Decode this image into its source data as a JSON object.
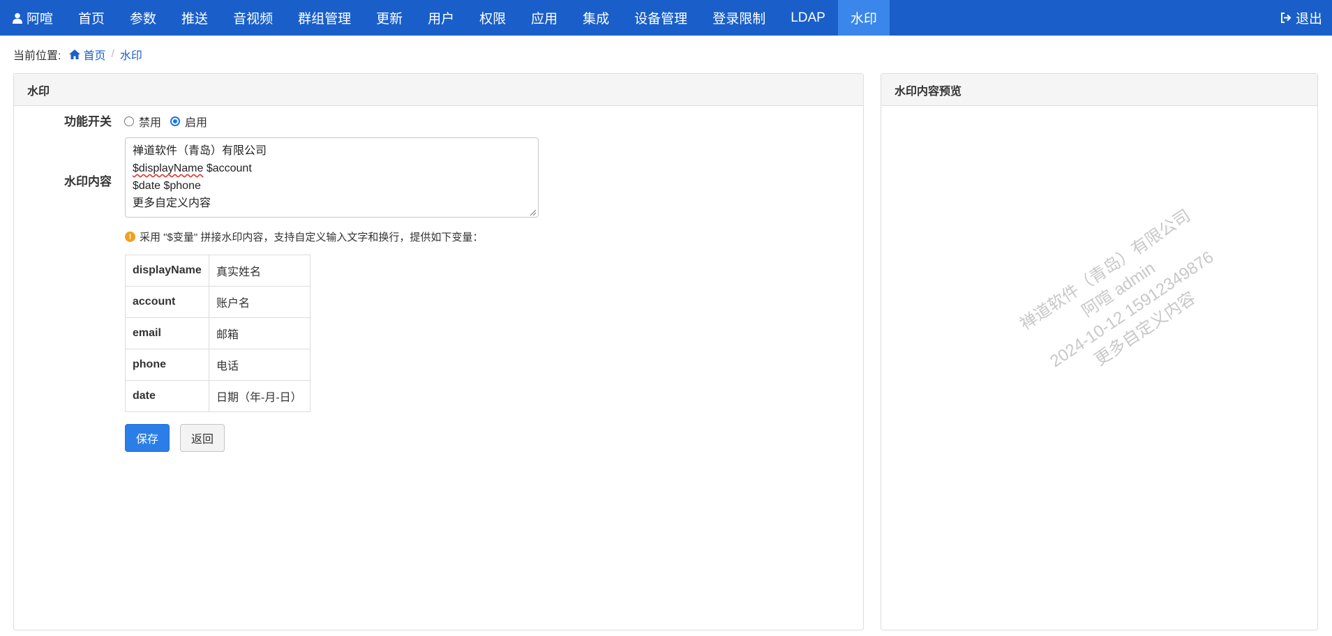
{
  "header": {
    "user": "阿喧",
    "nav": [
      "首页",
      "参数",
      "推送",
      "音视频",
      "群组管理",
      "更新",
      "用户",
      "权限",
      "应用",
      "集成",
      "设备管理",
      "登录限制",
      "LDAP",
      "水印"
    ],
    "active": "水印",
    "logout": "退出"
  },
  "breadcrumb": {
    "label": "当前位置:",
    "home": "首页",
    "current": "水印"
  },
  "form": {
    "panel_title": "水印",
    "switch_label": "功能开关",
    "disable_label": "禁用",
    "enable_label": "启用",
    "enabled": true,
    "content_label": "水印内容",
    "content_lines": [
      "禅道软件（青岛）有限公司",
      "$displayName $account",
      "$date $phone",
      "更多自定义内容"
    ],
    "tip": "采用 \"$变量\" 拼接水印内容，支持自定义输入文字和换行，提供如下变量：",
    "variables": [
      {
        "key": "displayName",
        "desc": "真实姓名"
      },
      {
        "key": "account",
        "desc": "账户名"
      },
      {
        "key": "email",
        "desc": "邮箱"
      },
      {
        "key": "phone",
        "desc": "电话"
      },
      {
        "key": "date",
        "desc": "日期（年-月-日）"
      }
    ],
    "save_label": "保存",
    "back_label": "返回"
  },
  "preview": {
    "panel_title": "水印内容预览",
    "lines": [
      "禅道软件（青岛）有限公司",
      "阿喧 admin",
      "2024-10-12 15912349876",
      "更多自定义内容"
    ]
  }
}
